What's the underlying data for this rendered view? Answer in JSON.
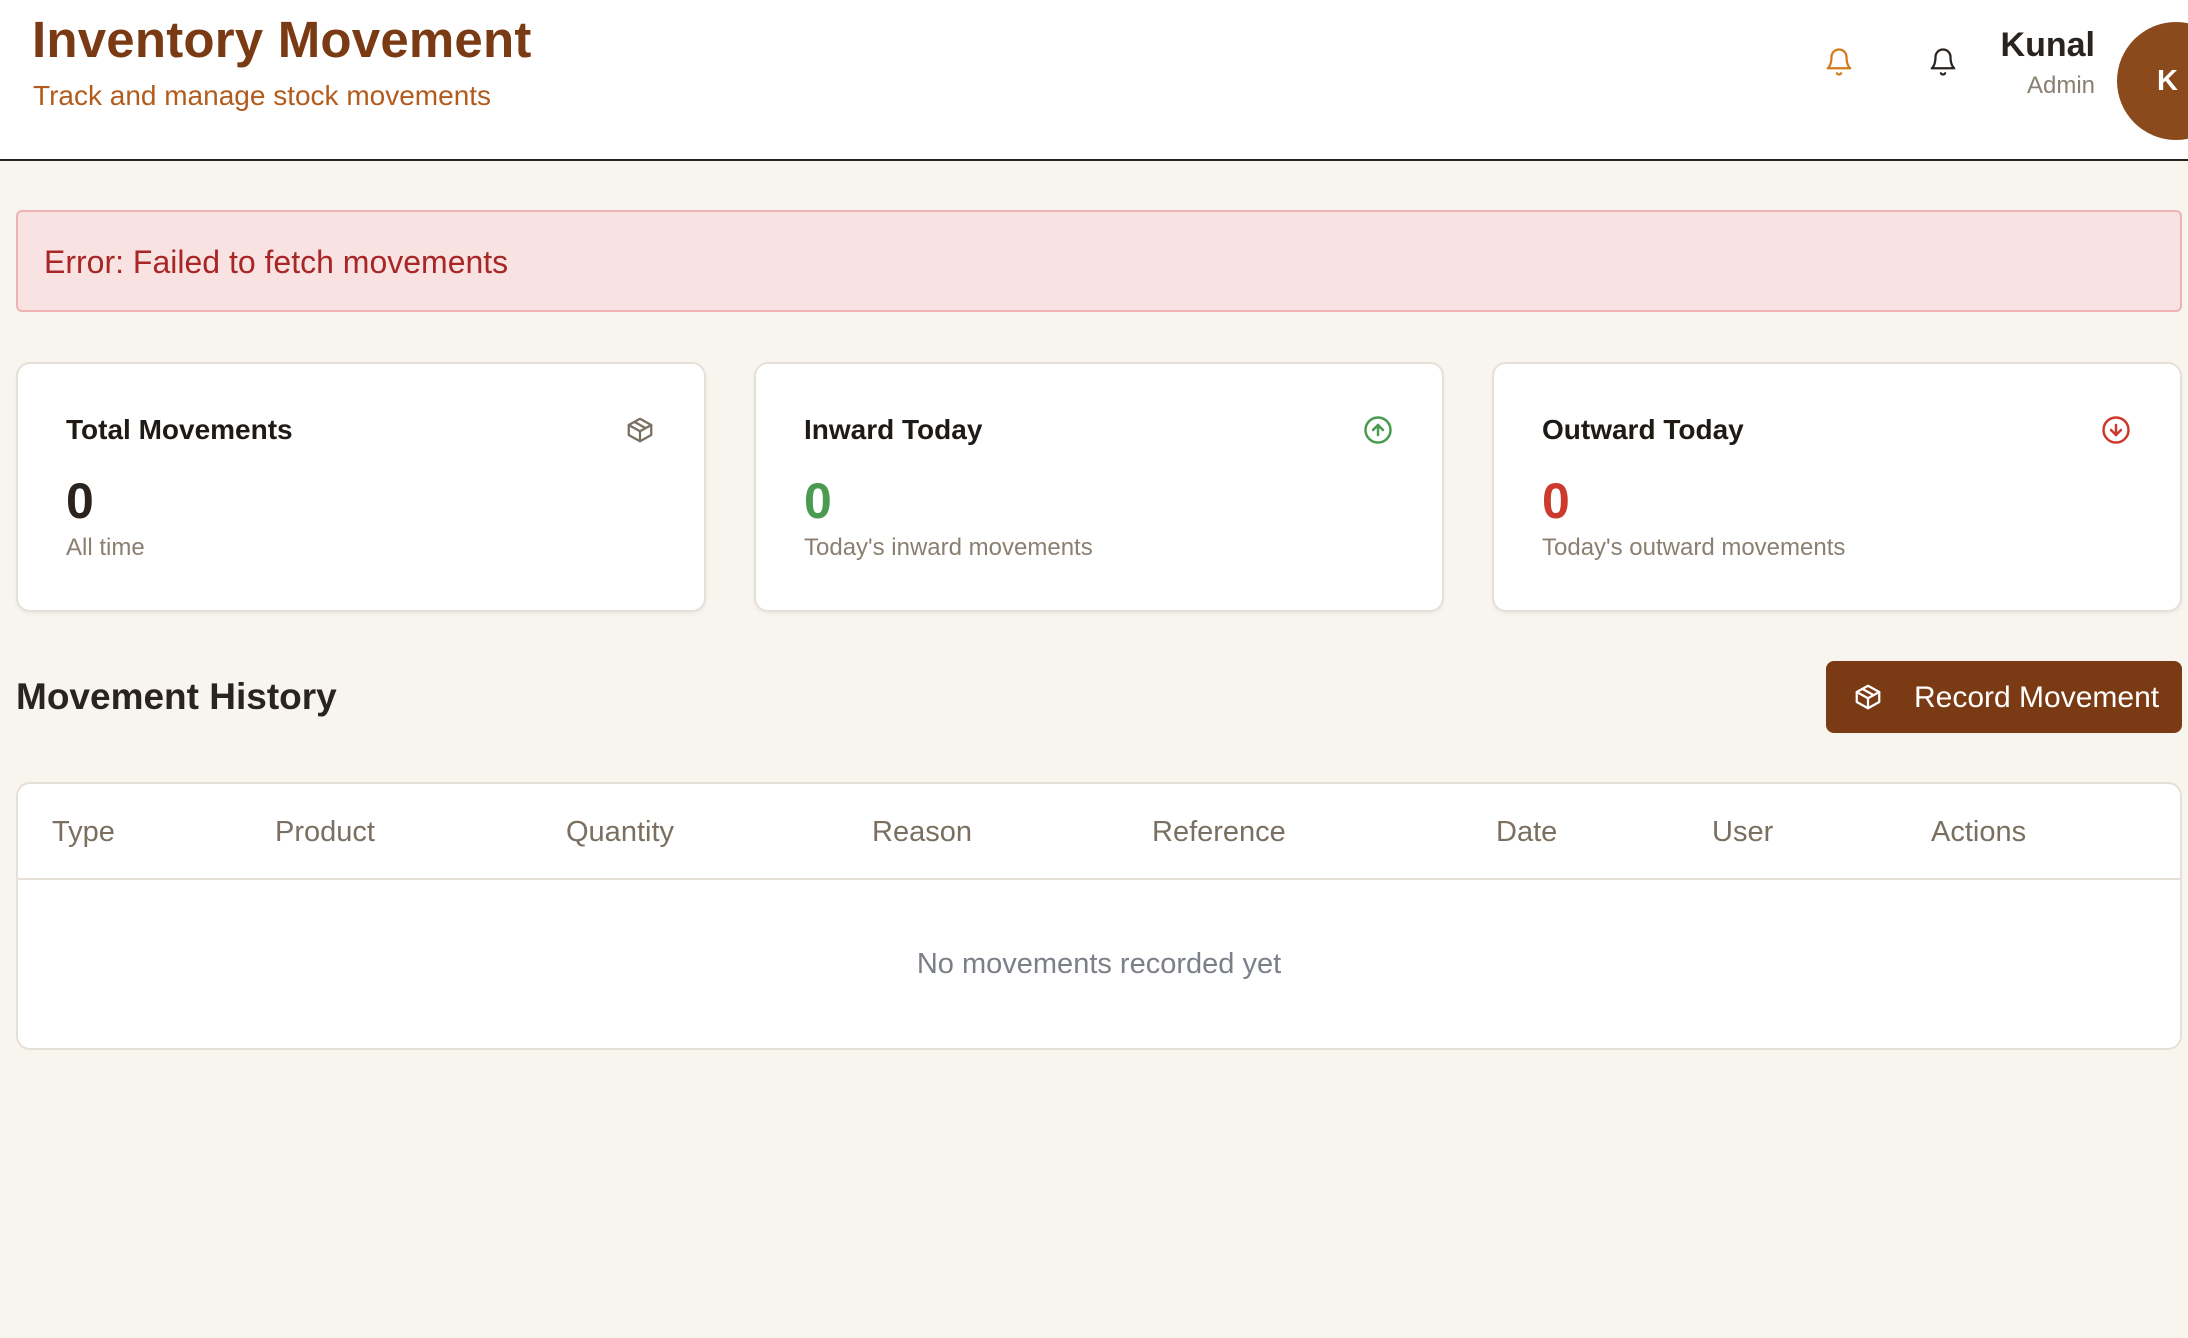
{
  "header": {
    "title": "Inventory Movement",
    "subtitle": "Track and manage stock movements",
    "notifications": [
      {
        "icon": "bell-icon",
        "color": "#d4781e"
      },
      {
        "icon": "bell-icon",
        "color": "#2a2420"
      }
    ],
    "user": {
      "name": "Kunal",
      "role": "Admin",
      "avatar_initial": "K",
      "avatar_color": "#8a4a1c"
    }
  },
  "error": {
    "message": "Error: Failed to fetch movements"
  },
  "stats": [
    {
      "title": "Total Movements",
      "value": "0",
      "description": "All time",
      "icon": "package-icon",
      "color": "#2a2420"
    },
    {
      "title": "Inward Today",
      "value": "0",
      "description": "Today's inward movements",
      "icon": "arrow-up-circle-icon",
      "color": "#4a9a50"
    },
    {
      "title": "Outward Today",
      "value": "0",
      "description": "Today's outward movements",
      "icon": "arrow-down-circle-icon",
      "color": "#cc3a2e"
    }
  ],
  "history": {
    "title": "Movement History",
    "record_button": {
      "label": "Record Movement",
      "icon": "package-icon"
    },
    "columns": [
      "Type",
      "Product",
      "Quantity",
      "Reason",
      "Reference",
      "Date",
      "User",
      "Actions"
    ],
    "rows": [],
    "empty_message": "No movements recorded yet"
  },
  "colors": {
    "brand": "#7a3a14",
    "brand_accent": "#b25b1c",
    "background": "#f8f5ef",
    "error_bg": "#f9e2e2",
    "error_text": "#a82626"
  }
}
